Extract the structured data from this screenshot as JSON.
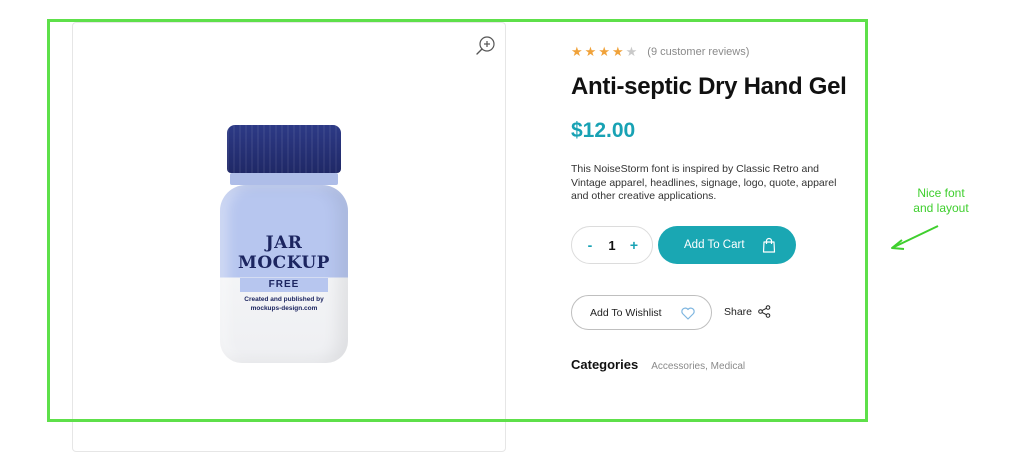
{
  "product": {
    "rating": {
      "value": 4,
      "max": 5,
      "reviews_text": "(9 customer reviews)"
    },
    "title": "Anti-septic Dry Hand Gel",
    "price": "$12.00",
    "description": "This NoiseStorm font is inspired by Classic Retro and Vintage apparel, headlines, signage, logo, quote, apparel and other creative applications.",
    "quantity": {
      "minus": "-",
      "value": "1",
      "plus": "+"
    },
    "add_to_cart": "Add To Cart",
    "wishlist": "Add To Wishlist",
    "share": "Share",
    "categories": {
      "label": "Categories",
      "items": [
        "Accessories",
        "Medical"
      ],
      "separator": ", "
    }
  },
  "product_image": {
    "jar_line1": "JAR",
    "jar_line2": "MOCKUP",
    "jar_badge": "FREE",
    "jar_small1": "Created and published by",
    "jar_small2": "mockups-design.com"
  },
  "annotation": {
    "text_line1": "Nice font",
    "text_line2": "and layout",
    "color": "#5ee04a"
  },
  "colors": {
    "accent": "#1aa7b3",
    "price": "#18a2b4",
    "star": "#f0a23a"
  },
  "icons": {
    "zoom": "zoom-in-icon",
    "bag": "shopping-bag-icon",
    "heart": "heart-icon",
    "share": "share-icon",
    "star": "star-icon"
  }
}
